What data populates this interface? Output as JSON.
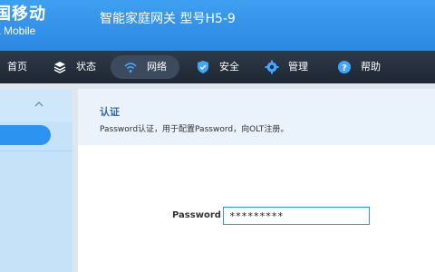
{
  "header": {
    "brand_cn": "国移动",
    "brand_en": "a Mobile",
    "gateway_title": "智能家庭网关 型号H5-9"
  },
  "nav": {
    "items": [
      {
        "label": "首页",
        "icon": "home-icon"
      },
      {
        "label": "状态",
        "icon": "layers-icon"
      },
      {
        "label": "网络",
        "icon": "wifi-icon",
        "active": true
      },
      {
        "label": "安全",
        "icon": "shield-icon"
      },
      {
        "label": "管理",
        "icon": "gear-icon"
      },
      {
        "label": "帮助",
        "icon": "help-icon"
      }
    ]
  },
  "info": {
    "title": "认证",
    "description": "Password认证，用于配置Password，向OLT注册。"
  },
  "form": {
    "password_label": "Password",
    "password_value": "*********"
  },
  "colors": {
    "header_blue": "#2a88e2",
    "nav_dark": "#253041",
    "accent": "#2c93f0"
  }
}
